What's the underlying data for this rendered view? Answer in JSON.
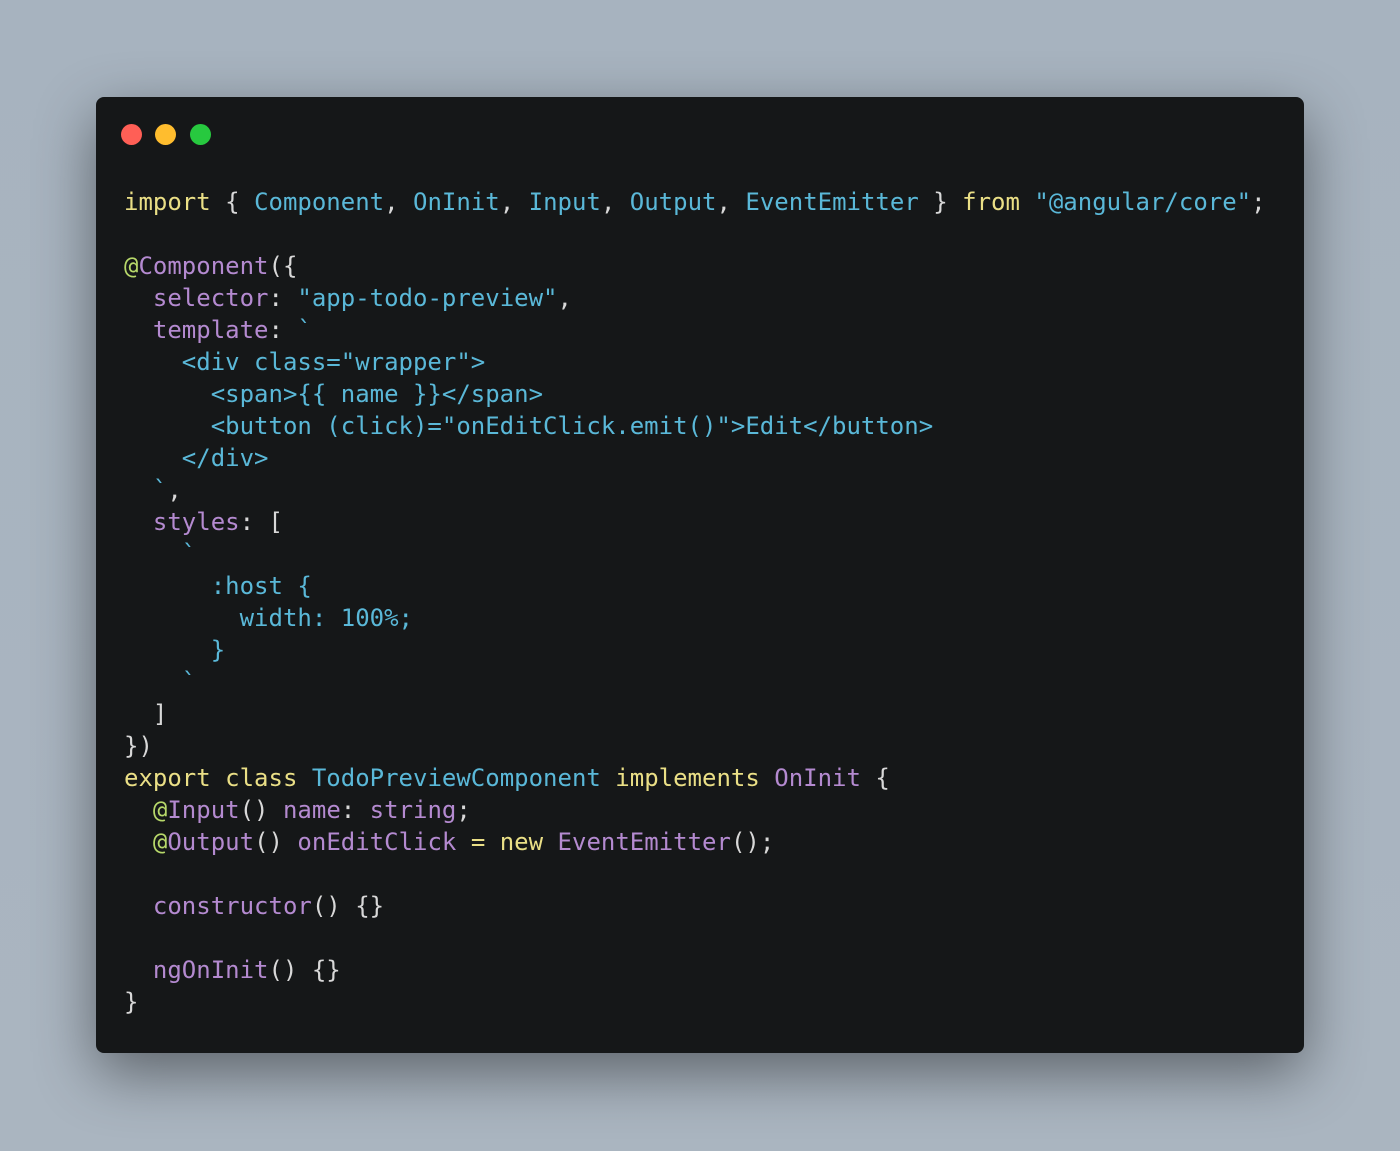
{
  "colors": {
    "keyword": "#eadf86",
    "type": "#5ab8d8",
    "string": "#5ab8d8",
    "property": "#b48ad0",
    "decorator": "#b7d86a",
    "punctuation": "#d8d8d8",
    "background": "#151718"
  },
  "window_controls": [
    {
      "name": "close",
      "color": "#ff5f56"
    },
    {
      "name": "minimize",
      "color": "#ffbd2e"
    },
    {
      "name": "maximize",
      "color": "#27c93f"
    }
  ],
  "code_lines": [
    [
      [
        "kw",
        "import"
      ],
      [
        "p",
        " { "
      ],
      [
        "ty",
        "Component"
      ],
      [
        "p",
        ", "
      ],
      [
        "ty",
        "OnInit"
      ],
      [
        "p",
        ", "
      ],
      [
        "ty",
        "Input"
      ],
      [
        "p",
        ", "
      ],
      [
        "ty",
        "Output"
      ],
      [
        "p",
        ", "
      ],
      [
        "ty",
        "EventEmitter"
      ],
      [
        "p",
        " } "
      ],
      [
        "kw",
        "from"
      ],
      [
        "p",
        " "
      ],
      [
        "st",
        "\"@angular/core\""
      ],
      [
        "p",
        ";"
      ]
    ],
    [],
    [
      [
        "gr",
        "@"
      ],
      [
        "pu",
        "Component"
      ],
      [
        "p",
        "({"
      ]
    ],
    [
      [
        "p",
        "  "
      ],
      [
        "pu",
        "selector"
      ],
      [
        "p",
        ": "
      ],
      [
        "st",
        "\"app-todo-preview\""
      ],
      [
        "p",
        ","
      ]
    ],
    [
      [
        "p",
        "  "
      ],
      [
        "pu",
        "template"
      ],
      [
        "p",
        ": "
      ],
      [
        "st",
        "`"
      ]
    ],
    [
      [
        "st",
        "    <div class=\"wrapper\">"
      ]
    ],
    [
      [
        "st",
        "      <span>{{ name }}</span>"
      ]
    ],
    [
      [
        "st",
        "      <button (click)=\"onEditClick.emit()\">Edit</button>"
      ]
    ],
    [
      [
        "st",
        "    </div>"
      ]
    ],
    [
      [
        "st",
        "  `"
      ],
      [
        "p",
        ","
      ]
    ],
    [
      [
        "p",
        "  "
      ],
      [
        "pu",
        "styles"
      ],
      [
        "p",
        ": ["
      ]
    ],
    [
      [
        "st",
        "    `"
      ]
    ],
    [
      [
        "st",
        "      :host {"
      ]
    ],
    [
      [
        "st",
        "        width: 100%;"
      ]
    ],
    [
      [
        "st",
        "      }"
      ]
    ],
    [
      [
        "st",
        "    `"
      ]
    ],
    [
      [
        "p",
        "  ]"
      ]
    ],
    [
      [
        "p",
        "})"
      ]
    ],
    [
      [
        "kw",
        "export"
      ],
      [
        "p",
        " "
      ],
      [
        "kw",
        "class"
      ],
      [
        "p",
        " "
      ],
      [
        "ty",
        "TodoPreviewComponent"
      ],
      [
        "p",
        " "
      ],
      [
        "kw",
        "implements"
      ],
      [
        "p",
        " "
      ],
      [
        "pu",
        "OnInit"
      ],
      [
        "p",
        " {"
      ]
    ],
    [
      [
        "p",
        "  "
      ],
      [
        "gr",
        "@"
      ],
      [
        "pu",
        "Input"
      ],
      [
        "p",
        "() "
      ],
      [
        "pu",
        "name"
      ],
      [
        "p",
        ": "
      ],
      [
        "pu",
        "string"
      ],
      [
        "p",
        ";"
      ]
    ],
    [
      [
        "p",
        "  "
      ],
      [
        "gr",
        "@"
      ],
      [
        "pu",
        "Output"
      ],
      [
        "p",
        "() "
      ],
      [
        "pu",
        "onEditClick"
      ],
      [
        "p",
        " "
      ],
      [
        "kw",
        "="
      ],
      [
        "p",
        " "
      ],
      [
        "kw",
        "new"
      ],
      [
        "p",
        " "
      ],
      [
        "pu",
        "EventEmitter"
      ],
      [
        "p",
        "();"
      ]
    ],
    [],
    [
      [
        "p",
        "  "
      ],
      [
        "pu",
        "constructor"
      ],
      [
        "p",
        "() {}"
      ]
    ],
    [],
    [
      [
        "p",
        "  "
      ],
      [
        "pu",
        "ngOnInit"
      ],
      [
        "p",
        "() {}"
      ]
    ],
    [
      [
        "p",
        "}"
      ]
    ]
  ]
}
